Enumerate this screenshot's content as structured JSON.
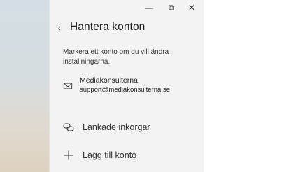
{
  "window": {
    "minimize_glyph": "—",
    "maximize_glyph": "⧉",
    "close_glyph": "✕"
  },
  "panel": {
    "back_glyph": "‹",
    "title": "Hantera konton",
    "hint": "Markera ett konto om du vill ändra inställningarna."
  },
  "accounts": [
    {
      "name": "Mediakonsulterna",
      "email": "support@mediakonsulterna.se",
      "icon": "mail-icon"
    }
  ],
  "actions": {
    "linked_inboxes": {
      "label": "Länkade inkorgar",
      "icon": "linked-inboxes-icon"
    },
    "add_account": {
      "label": "Lägg till konto",
      "icon": "plus-icon"
    }
  },
  "colors": {
    "pane_background": "#f3f3f3",
    "text": "#222222"
  }
}
